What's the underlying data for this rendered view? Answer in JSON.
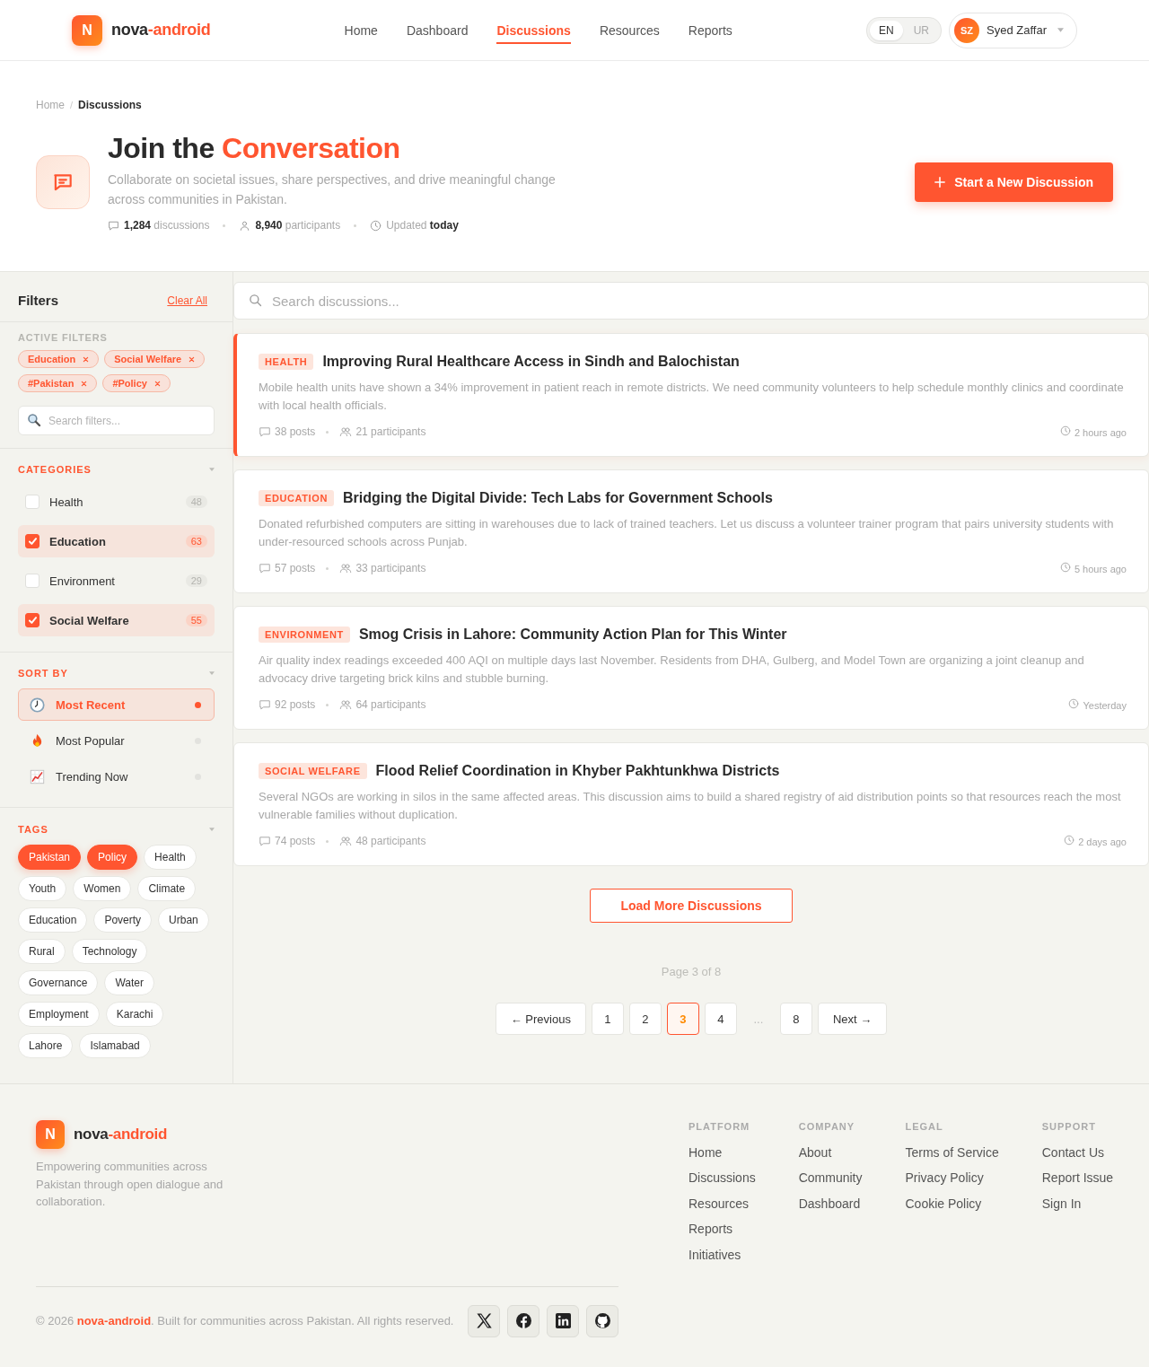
{
  "header": {
    "brand": {
      "mark": "N",
      "name": "nova",
      "accent": "-android"
    },
    "nav": [
      {
        "label": "Home",
        "selected": false
      },
      {
        "label": "Dashboard",
        "selected": false
      },
      {
        "label": "Discussions",
        "selected": true
      },
      {
        "label": "Resources",
        "selected": false
      },
      {
        "label": "Reports",
        "selected": false
      }
    ],
    "languages": [
      {
        "label": "EN",
        "selected": true
      },
      {
        "label": "UR",
        "selected": false
      }
    ],
    "user": {
      "initials": "SZ",
      "name": "Syed Zaffar"
    }
  },
  "hero": {
    "breadcrumb": [
      {
        "label": "Home",
        "current": false
      },
      {
        "label": "Discussions",
        "current": true
      }
    ],
    "breadcrumb_separator": "/",
    "title": "Join the",
    "title_accent": "Conversation",
    "subtitle": "Collaborate on societal issues, share perspectives, and drive meaningful change across communities in Pakistan.",
    "stats": [
      {
        "kind": "discussions",
        "value": "1,284",
        "label": "discussions"
      },
      {
        "kind": "participants",
        "value": "8,940",
        "label": "participants"
      },
      {
        "kind": "updated",
        "label": "Updated",
        "value": "today"
      }
    ],
    "action": "Start a New Discussion"
  },
  "sidebar": {
    "title": "Filters",
    "clear_label": "Clear All",
    "active": {
      "heading": "ACTIVE FILTERS",
      "chips": [
        "Education",
        "Social Welfare",
        "#Pakistan",
        "#Policy"
      ]
    },
    "search": {
      "placeholder": "Search filters..."
    },
    "categories": {
      "heading": "CATEGORIES",
      "expanded": true,
      "items": [
        {
          "label": "Health",
          "count": "48",
          "checked": false
        },
        {
          "label": "Education",
          "count": "63",
          "checked": true
        },
        {
          "label": "Environment",
          "count": "29",
          "checked": false
        },
        {
          "label": "Social Welfare",
          "count": "55",
          "checked": true
        }
      ]
    },
    "sort": {
      "heading": "SORT BY",
      "expanded": true,
      "options": [
        {
          "kind": "recent",
          "label": "Most Recent",
          "selected": true
        },
        {
          "kind": "popular",
          "label": "Most Popular",
          "selected": false
        },
        {
          "kind": "trending",
          "label": "Trending Now",
          "selected": false
        }
      ]
    },
    "tags": {
      "heading": "TAGS",
      "expanded": true,
      "items": [
        {
          "label": "Pakistan",
          "selected": true
        },
        {
          "label": "Policy",
          "selected": true
        },
        {
          "label": "Health",
          "selected": false
        },
        {
          "label": "Youth",
          "selected": false
        },
        {
          "label": "Women",
          "selected": false
        },
        {
          "label": "Climate",
          "selected": false
        },
        {
          "label": "Education",
          "selected": false
        },
        {
          "label": "Poverty",
          "selected": false
        },
        {
          "label": "Urban",
          "selected": false
        },
        {
          "label": "Rural",
          "selected": false
        },
        {
          "label": "Technology",
          "selected": false
        },
        {
          "label": "Governance",
          "selected": false
        },
        {
          "label": "Water",
          "selected": false
        },
        {
          "label": "Employment",
          "selected": false
        },
        {
          "label": "Karachi",
          "selected": false
        },
        {
          "label": "Lahore",
          "selected": false
        },
        {
          "label": "Islamabad",
          "selected": false
        }
      ]
    }
  },
  "discussions": {
    "search": {
      "placeholder": "Search discussions..."
    },
    "items": [
      {
        "category": "HEALTH",
        "title": "Improving Rural Healthcare Access in Sindh and Balochistan",
        "excerpt": "Mobile health units have shown a 34% improvement in patient reach in remote districts. We need community volunteers to help schedule monthly clinics and coordinate with local health officials.",
        "posts": "38 posts",
        "participants": "21 participants",
        "time": "2 hours ago",
        "selected": true
      },
      {
        "category": "EDUCATION",
        "title": "Bridging the Digital Divide: Tech Labs for Government Schools",
        "excerpt": "Donated refurbished computers are sitting in warehouses due to lack of trained teachers. Let us discuss a volunteer trainer program that pairs university students with under-resourced schools across Punjab.",
        "posts": "57 posts",
        "participants": "33 participants",
        "time": "5 hours ago",
        "selected": false
      },
      {
        "category": "ENVIRONMENT",
        "title": "Smog Crisis in Lahore: Community Action Plan for This Winter",
        "excerpt": "Air quality index readings exceeded 400 AQI on multiple days last November. Residents from DHA, Gulberg, and Model Town are organizing a joint cleanup and advocacy drive targeting brick kilns and stubble burning.",
        "posts": "92 posts",
        "participants": "64 participants",
        "time": "Yesterday",
        "selected": false
      },
      {
        "category": "SOCIAL WELFARE",
        "title": "Flood Relief Coordination in Khyber Pakhtunkhwa Districts",
        "excerpt": "Several NGOs are working in silos in the same affected areas. This discussion aims to build a shared registry of aid distribution points so that resources reach the most vulnerable families without duplication.",
        "posts": "74 posts",
        "participants": "48 participants",
        "time": "2 days ago",
        "selected": false
      }
    ],
    "load_more": "Load More Discussions"
  },
  "pagination": {
    "summary": "Page 3 of 8",
    "previous": "← Previous",
    "next": "Next →",
    "pages": [
      {
        "kind": "page",
        "label": "1",
        "selected": false
      },
      {
        "kind": "page",
        "label": "2",
        "selected": false
      },
      {
        "kind": "page",
        "label": "3",
        "selected": true
      },
      {
        "kind": "page",
        "label": "4",
        "selected": false
      },
      {
        "kind": "gap",
        "label": "..."
      },
      {
        "kind": "page",
        "label": "8",
        "selected": false
      }
    ]
  },
  "footer": {
    "brand": {
      "mark": "N",
      "name": "nova",
      "accent": "-android"
    },
    "tagline": "Empowering communities across Pakistan through open dialogue and collaboration.",
    "columns": [
      {
        "heading": "PLATFORM",
        "links": [
          "Home",
          "Discussions",
          "Resources",
          "Reports",
          "Initiatives"
        ]
      },
      {
        "heading": "COMPANY",
        "links": [
          "About",
          "Community",
          "Dashboard"
        ]
      },
      {
        "heading": "LEGAL",
        "links": [
          "Terms of Service",
          "Privacy Policy",
          "Cookie Policy"
        ]
      },
      {
        "heading": "SUPPORT",
        "links": [
          "Contact Us",
          "Report Issue",
          "Sign In"
        ]
      }
    ],
    "copyright": {
      "before": "© 2026 ",
      "link": "nova-android",
      "after": ". Built for communities across Pakistan. All rights reserved."
    }
  }
}
